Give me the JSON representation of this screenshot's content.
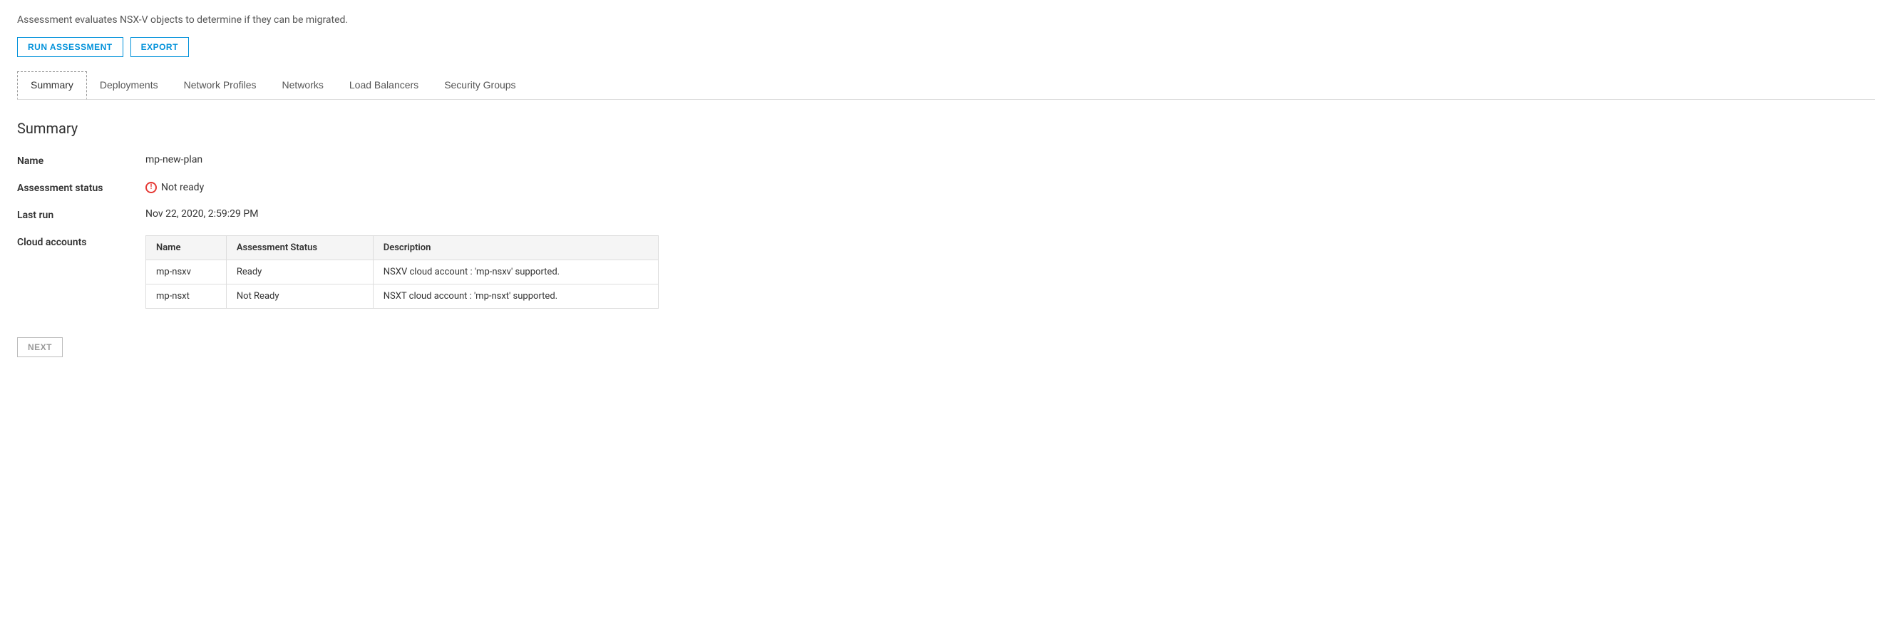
{
  "description": "Assessment evaluates NSX-V objects to determine if they can be migrated.",
  "toolbar": {
    "run_assessment_label": "RUN ASSESSMENT",
    "export_label": "EXPORT"
  },
  "tabs": [
    {
      "id": "summary",
      "label": "Summary",
      "active": true
    },
    {
      "id": "deployments",
      "label": "Deployments",
      "active": false
    },
    {
      "id": "network-profiles",
      "label": "Network Profiles",
      "active": false
    },
    {
      "id": "networks",
      "label": "Networks",
      "active": false
    },
    {
      "id": "load-balancers",
      "label": "Load Balancers",
      "active": false
    },
    {
      "id": "security-groups",
      "label": "Security Groups",
      "active": false
    }
  ],
  "summary": {
    "title": "Summary",
    "fields": {
      "name_label": "Name",
      "name_value": "mp-new-plan",
      "assessment_status_label": "Assessment status",
      "assessment_status_value": "Not ready",
      "last_run_label": "Last run",
      "last_run_value": "Nov 22, 2020, 2:59:29 PM",
      "cloud_accounts_label": "Cloud accounts"
    },
    "cloud_accounts_table": {
      "columns": [
        "Name",
        "Assessment Status",
        "Description"
      ],
      "rows": [
        {
          "name": "mp-nsxv",
          "assessment_status": "Ready",
          "description": "NSXV cloud account : 'mp-nsxv' supported."
        },
        {
          "name": "mp-nsxt",
          "assessment_status": "Not Ready",
          "description": "NSXT cloud account : 'mp-nsxt' supported."
        }
      ]
    }
  },
  "footer": {
    "next_label": "NEXT"
  }
}
